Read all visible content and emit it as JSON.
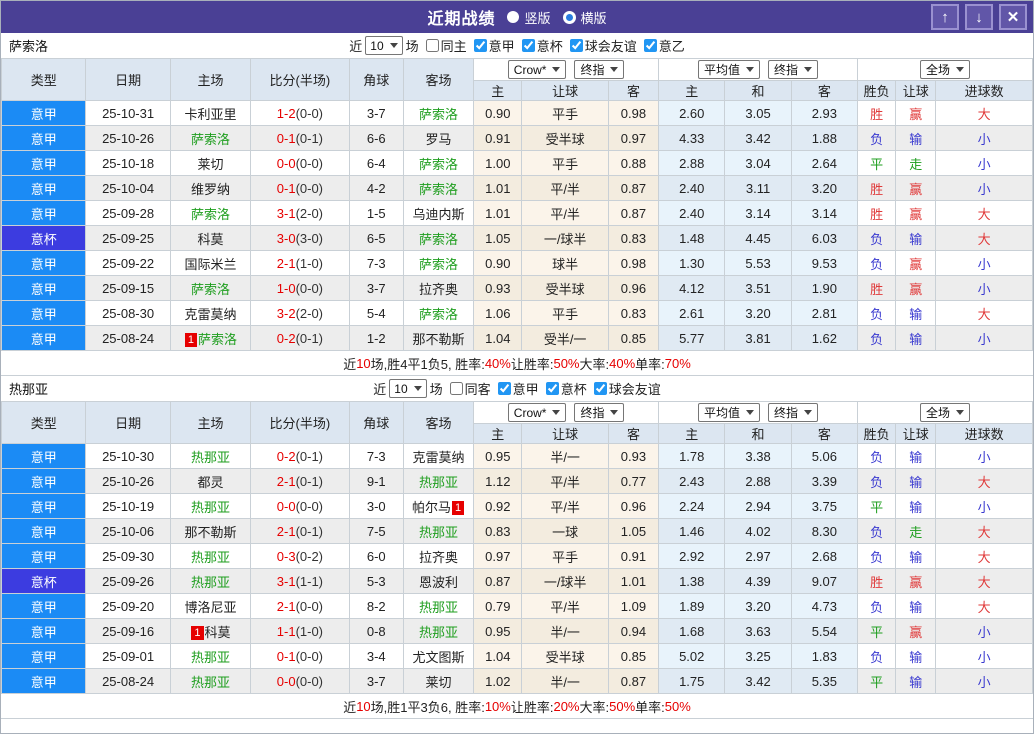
{
  "colors": {
    "titlebar_bg": "#4a4095",
    "titlebar_btn_bg": "#6156a8",
    "titlebar_btn_border": "#9a91d0",
    "league_badge": "#1b8bf5",
    "cup_badge": "#3c3ce0",
    "header_bg": "#dce6f1",
    "focus_team_green": "#1e9e1e",
    "score_red": "#e60000",
    "win_red": "#e03a3a",
    "lose_blue": "#3a3ad0",
    "draw_green": "#1e9e1e",
    "checkbox_blue": "#2196f3",
    "odds_bg": "#fbf4ea",
    "avg_bg": "#e8f3fb"
  },
  "titlebar": {
    "title": "近期战绩",
    "radios": [
      {
        "label": "竖版",
        "selected": false
      },
      {
        "label": "横版",
        "selected": true
      }
    ],
    "buttons": {
      "up": "↑",
      "down": "↓",
      "close": "✕"
    }
  },
  "table_header": {
    "left": [
      "类型",
      "日期",
      "主场",
      "比分(半场)",
      "角球",
      "客场"
    ],
    "group1_selects": [
      "Crow*",
      "终指"
    ],
    "group1_cols": [
      "主",
      "让球",
      "客"
    ],
    "group2_selects": [
      "平均值",
      "终指"
    ],
    "group2_cols": [
      "主",
      "和",
      "客"
    ],
    "group3_select": "全场",
    "group3_cols": [
      "胜负",
      "让球",
      "进球数"
    ]
  },
  "sections": [
    {
      "team": "萨索洛",
      "filter": {
        "near_label": "近",
        "count": "10",
        "games_label": "场",
        "same_checkbox": {
          "label": "同主",
          "checked": false
        },
        "league_checkboxes": [
          {
            "label": "意甲",
            "checked": true
          },
          {
            "label": "意杯",
            "checked": true
          },
          {
            "label": "球会友谊",
            "checked": true
          },
          {
            "label": "意乙",
            "checked": true
          }
        ]
      },
      "rows": [
        {
          "league": "意甲",
          "date": "25-10-31",
          "home": "卡利亚里",
          "score": "1-2",
          "half": "(0-0)",
          "corner": "3-7",
          "away": "萨索洛",
          "away_focus": true,
          "odds": [
            "0.90",
            "平手",
            "0.98"
          ],
          "avg": [
            "2.60",
            "3.05",
            "2.93"
          ],
          "result": [
            "胜",
            "赢",
            "大"
          ]
        },
        {
          "league": "意甲",
          "date": "25-10-26",
          "home": "萨索洛",
          "home_focus": true,
          "score": "0-1",
          "half": "(0-1)",
          "corner": "6-6",
          "away": "罗马",
          "odds": [
            "0.91",
            "受半球",
            "0.97"
          ],
          "avg": [
            "4.33",
            "3.42",
            "1.88"
          ],
          "result": [
            "负",
            "输",
            "小"
          ]
        },
        {
          "league": "意甲",
          "date": "25-10-18",
          "home": "莱切",
          "score": "0-0",
          "half": "(0-0)",
          "corner": "6-4",
          "away": "萨索洛",
          "away_focus": true,
          "odds": [
            "1.00",
            "平手",
            "0.88"
          ],
          "avg": [
            "2.88",
            "3.04",
            "2.64"
          ],
          "result": [
            "平",
            "走",
            "小"
          ]
        },
        {
          "league": "意甲",
          "date": "25-10-04",
          "home": "维罗纳",
          "score": "0-1",
          "half": "(0-0)",
          "corner": "4-2",
          "away": "萨索洛",
          "away_focus": true,
          "odds": [
            "1.01",
            "平/半",
            "0.87"
          ],
          "avg": [
            "2.40",
            "3.11",
            "3.20"
          ],
          "result": [
            "胜",
            "赢",
            "小"
          ]
        },
        {
          "league": "意甲",
          "date": "25-09-28",
          "home": "萨索洛",
          "home_focus": true,
          "score": "3-1",
          "half": "(2-0)",
          "corner": "1-5",
          "away": "乌迪内斯",
          "odds": [
            "1.01",
            "平/半",
            "0.87"
          ],
          "avg": [
            "2.40",
            "3.14",
            "3.14"
          ],
          "result": [
            "胜",
            "赢",
            "大"
          ]
        },
        {
          "league": "意杯",
          "date": "25-09-25",
          "home": "科莫",
          "score": "3-0",
          "half": "(3-0)",
          "corner": "6-5",
          "away": "萨索洛",
          "away_focus": true,
          "odds": [
            "1.05",
            "一/球半",
            "0.83"
          ],
          "avg": [
            "1.48",
            "4.45",
            "6.03"
          ],
          "result": [
            "负",
            "输",
            "大"
          ]
        },
        {
          "league": "意甲",
          "date": "25-09-22",
          "home": "国际米兰",
          "score": "2-1",
          "half": "(1-0)",
          "corner": "7-3",
          "away": "萨索洛",
          "away_focus": true,
          "odds": [
            "0.90",
            "球半",
            "0.98"
          ],
          "avg": [
            "1.30",
            "5.53",
            "9.53"
          ],
          "result": [
            "负",
            "赢",
            "小"
          ]
        },
        {
          "league": "意甲",
          "date": "25-09-15",
          "home": "萨索洛",
          "home_focus": true,
          "score": "1-0",
          "half": "(0-0)",
          "corner": "3-7",
          "away": "拉齐奥",
          "odds": [
            "0.93",
            "受半球",
            "0.96"
          ],
          "avg": [
            "4.12",
            "3.51",
            "1.90"
          ],
          "result": [
            "胜",
            "赢",
            "小"
          ]
        },
        {
          "league": "意甲",
          "date": "25-08-30",
          "home": "克雷莫纳",
          "score": "3-2",
          "half": "(2-0)",
          "corner": "5-4",
          "away": "萨索洛",
          "away_focus": true,
          "odds": [
            "1.06",
            "平手",
            "0.83"
          ],
          "avg": [
            "2.61",
            "3.20",
            "2.81"
          ],
          "result": [
            "负",
            "输",
            "大"
          ]
        },
        {
          "league": "意甲",
          "date": "25-08-24",
          "home": "萨索洛",
          "home_focus": true,
          "home_badge": "1",
          "home_badge_pos": "before",
          "score": "0-2",
          "half": "(0-1)",
          "corner": "1-2",
          "away": "那不勒斯",
          "odds": [
            "1.04",
            "受半/一",
            "0.85"
          ],
          "avg": [
            "5.77",
            "3.81",
            "1.62"
          ],
          "result": [
            "负",
            "输",
            "小"
          ]
        }
      ],
      "summary": [
        [
          "近",
          "k"
        ],
        [
          "10",
          "r"
        ],
        [
          "场,胜4平1负5, 胜率:",
          "k"
        ],
        [
          "40%",
          "r"
        ],
        [
          " 让胜率:",
          "k"
        ],
        [
          "50%",
          "r"
        ],
        [
          " 大率:",
          "k"
        ],
        [
          "40%",
          "r"
        ],
        [
          " 单率:",
          "k"
        ],
        [
          "70%",
          "r"
        ]
      ]
    },
    {
      "team": "热那亚",
      "filter": {
        "near_label": "近",
        "count": "10",
        "games_label": "场",
        "same_checkbox": {
          "label": "同客",
          "checked": false
        },
        "league_checkboxes": [
          {
            "label": "意甲",
            "checked": true
          },
          {
            "label": "意杯",
            "checked": true
          },
          {
            "label": "球会友谊",
            "checked": true
          }
        ]
      },
      "rows": [
        {
          "league": "意甲",
          "date": "25-10-30",
          "home": "热那亚",
          "home_focus": true,
          "score": "0-2",
          "half": "(0-1)",
          "corner": "7-3",
          "away": "克雷莫纳",
          "odds": [
            "0.95",
            "半/一",
            "0.93"
          ],
          "avg": [
            "1.78",
            "3.38",
            "5.06"
          ],
          "result": [
            "负",
            "输",
            "小"
          ]
        },
        {
          "league": "意甲",
          "date": "25-10-26",
          "home": "都灵",
          "score": "2-1",
          "half": "(0-1)",
          "corner": "9-1",
          "away": "热那亚",
          "away_focus": true,
          "odds": [
            "1.12",
            "平/半",
            "0.77"
          ],
          "avg": [
            "2.43",
            "2.88",
            "3.39"
          ],
          "result": [
            "负",
            "输",
            "大"
          ]
        },
        {
          "league": "意甲",
          "date": "25-10-19",
          "home": "热那亚",
          "home_focus": true,
          "score": "0-0",
          "half": "(0-0)",
          "corner": "3-0",
          "away": "帕尔马",
          "away_badge": "1",
          "away_badge_pos": "after",
          "odds": [
            "0.92",
            "平/半",
            "0.96"
          ],
          "avg": [
            "2.24",
            "2.94",
            "3.75"
          ],
          "result": [
            "平",
            "输",
            "小"
          ]
        },
        {
          "league": "意甲",
          "date": "25-10-06",
          "home": "那不勒斯",
          "score": "2-1",
          "half": "(0-1)",
          "corner": "7-5",
          "away": "热那亚",
          "away_focus": true,
          "odds": [
            "0.83",
            "一球",
            "1.05"
          ],
          "avg": [
            "1.46",
            "4.02",
            "8.30"
          ],
          "result": [
            "负",
            "走",
            "大"
          ]
        },
        {
          "league": "意甲",
          "date": "25-09-30",
          "home": "热那亚",
          "home_focus": true,
          "score": "0-3",
          "half": "(0-2)",
          "corner": "6-0",
          "away": "拉齐奥",
          "odds": [
            "0.97",
            "平手",
            "0.91"
          ],
          "avg": [
            "2.92",
            "2.97",
            "2.68"
          ],
          "result": [
            "负",
            "输",
            "大"
          ]
        },
        {
          "league": "意杯",
          "date": "25-09-26",
          "home": "热那亚",
          "home_focus": true,
          "score": "3-1",
          "half": "(1-1)",
          "corner": "5-3",
          "away": "恩波利",
          "odds": [
            "0.87",
            "一/球半",
            "1.01"
          ],
          "avg": [
            "1.38",
            "4.39",
            "9.07"
          ],
          "result": [
            "胜",
            "赢",
            "大"
          ]
        },
        {
          "league": "意甲",
          "date": "25-09-20",
          "home": "博洛尼亚",
          "score": "2-1",
          "half": "(0-0)",
          "corner": "8-2",
          "away": "热那亚",
          "away_focus": true,
          "odds": [
            "0.79",
            "平/半",
            "1.09"
          ],
          "avg": [
            "1.89",
            "3.20",
            "4.73"
          ],
          "result": [
            "负",
            "输",
            "大"
          ]
        },
        {
          "league": "意甲",
          "date": "25-09-16",
          "home": "科莫",
          "home_badge": "1",
          "home_badge_pos": "before",
          "score": "1-1",
          "half": "(1-0)",
          "corner": "0-8",
          "away": "热那亚",
          "away_focus": true,
          "odds": [
            "0.95",
            "半/一",
            "0.94"
          ],
          "avg": [
            "1.68",
            "3.63",
            "5.54"
          ],
          "result": [
            "平",
            "赢",
            "小"
          ]
        },
        {
          "league": "意甲",
          "date": "25-09-01",
          "home": "热那亚",
          "home_focus": true,
          "score": "0-1",
          "half": "(0-0)",
          "corner": "3-4",
          "away": "尤文图斯",
          "odds": [
            "1.04",
            "受半球",
            "0.85"
          ],
          "avg": [
            "5.02",
            "3.25",
            "1.83"
          ],
          "result": [
            "负",
            "输",
            "小"
          ]
        },
        {
          "league": "意甲",
          "date": "25-08-24",
          "home": "热那亚",
          "home_focus": true,
          "score": "0-0",
          "half": "(0-0)",
          "corner": "3-7",
          "away": "莱切",
          "odds": [
            "1.02",
            "半/一",
            "0.87"
          ],
          "avg": [
            "1.75",
            "3.42",
            "5.35"
          ],
          "result": [
            "平",
            "输",
            "小"
          ]
        }
      ],
      "summary": [
        [
          "近",
          "k"
        ],
        [
          "10",
          "r"
        ],
        [
          "场,胜1平3负6, 胜率:",
          "k"
        ],
        [
          "10%",
          "r"
        ],
        [
          " 让胜率:",
          "k"
        ],
        [
          "20%",
          "r"
        ],
        [
          " 大率:",
          "k"
        ],
        [
          "50%",
          "r"
        ],
        [
          " 单率:",
          "k"
        ],
        [
          "50%",
          "r"
        ]
      ]
    }
  ]
}
